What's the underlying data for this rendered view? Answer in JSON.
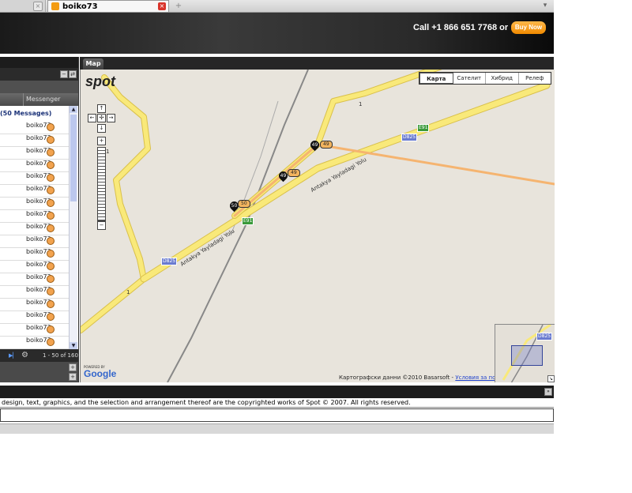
{
  "browser": {
    "tab_title": "boiko73",
    "new_tab_glyph": "+",
    "close_glyph": "×"
  },
  "header": {
    "call_text": "Call +1 866 651 7768 or",
    "buy_now": "Buy Now"
  },
  "left_panel": {
    "column_header": "Messenger",
    "message_count": "(50 Messages)",
    "rows": [
      "boiko73",
      "boiko73",
      "boiko73",
      "boiko73",
      "boiko73",
      "boiko73",
      "boiko73",
      "boiko73",
      "boiko73",
      "boiko73",
      "boiko73",
      "boiko73",
      "boiko73",
      "boiko73",
      "boiko73",
      "boiko73",
      "boiko73",
      "boiko73",
      "boiko73"
    ],
    "pager_range": "1 - 50 of 160"
  },
  "map_panel": {
    "tab_label": "Map",
    "map_types": [
      "Карта",
      "Сателит",
      "Хибрид",
      "Релеф"
    ],
    "active_map_type": "Карта",
    "logo": "spot",
    "road_labels": [
      "Antakya Yayladagi Yolu",
      "Antakya Yayladagi Yolu",
      "1",
      "1",
      "1"
    ],
    "shields": {
      "d825_a": "D825",
      "d825_b": "D825",
      "d825_ov": "D825",
      "e91_a": "E91",
      "e91_b": "E91"
    },
    "markers": [
      {
        "label": "49",
        "badge": "49"
      },
      {
        "label": "49",
        "badge": "49"
      },
      {
        "label": "50",
        "badge": "50"
      }
    ],
    "powered_by": "POWERED BY",
    "google": "Google",
    "copyright": "Картографски данни ©2010 Basarsoft -",
    "terms_link": "Условия за ползване"
  },
  "footer": {
    "legal_text": "design, text, graphics, and the selection and arrangement thereof are the copyrighted works of Spot © 2007. All rights reserved."
  },
  "colors": {
    "accent_orange": "#f08a00",
    "road_yellow": "#f9e97a",
    "track_orange": "#f5b470"
  }
}
